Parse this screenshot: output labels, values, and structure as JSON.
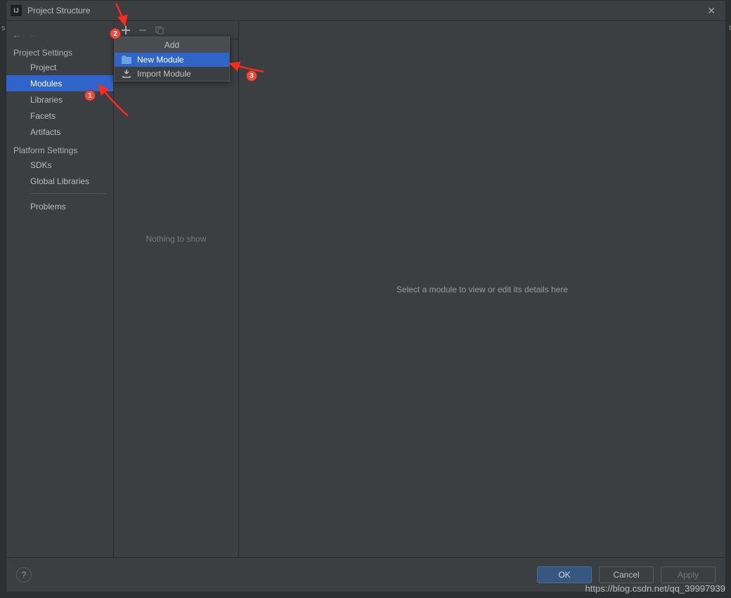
{
  "titlebar": {
    "title": "Project Structure"
  },
  "sidebar": {
    "groups": [
      {
        "label": "Project Settings",
        "items": [
          {
            "label": "Project"
          },
          {
            "label": "Modules",
            "selected": true
          },
          {
            "label": "Libraries"
          },
          {
            "label": "Facets"
          },
          {
            "label": "Artifacts"
          }
        ]
      },
      {
        "label": "Platform Settings",
        "items": [
          {
            "label": "SDKs"
          },
          {
            "label": "Global Libraries"
          }
        ]
      }
    ],
    "problems": "Problems"
  },
  "middle": {
    "placeholder": "Nothing to show"
  },
  "right": {
    "placeholder": "Select a module to view or edit its details here"
  },
  "buttons": {
    "ok": "OK",
    "cancel": "Cancel",
    "apply": "Apply"
  },
  "popup": {
    "title": "Add",
    "items": [
      {
        "label": "New Module",
        "selected": true
      },
      {
        "label": "Import Module"
      }
    ]
  },
  "annotations": {
    "b1": "1",
    "b2": "2",
    "b3": "3"
  },
  "watermark": "https://blog.csdn.net/qq_39997939",
  "edge": {
    "left": "s",
    "right": "t"
  }
}
